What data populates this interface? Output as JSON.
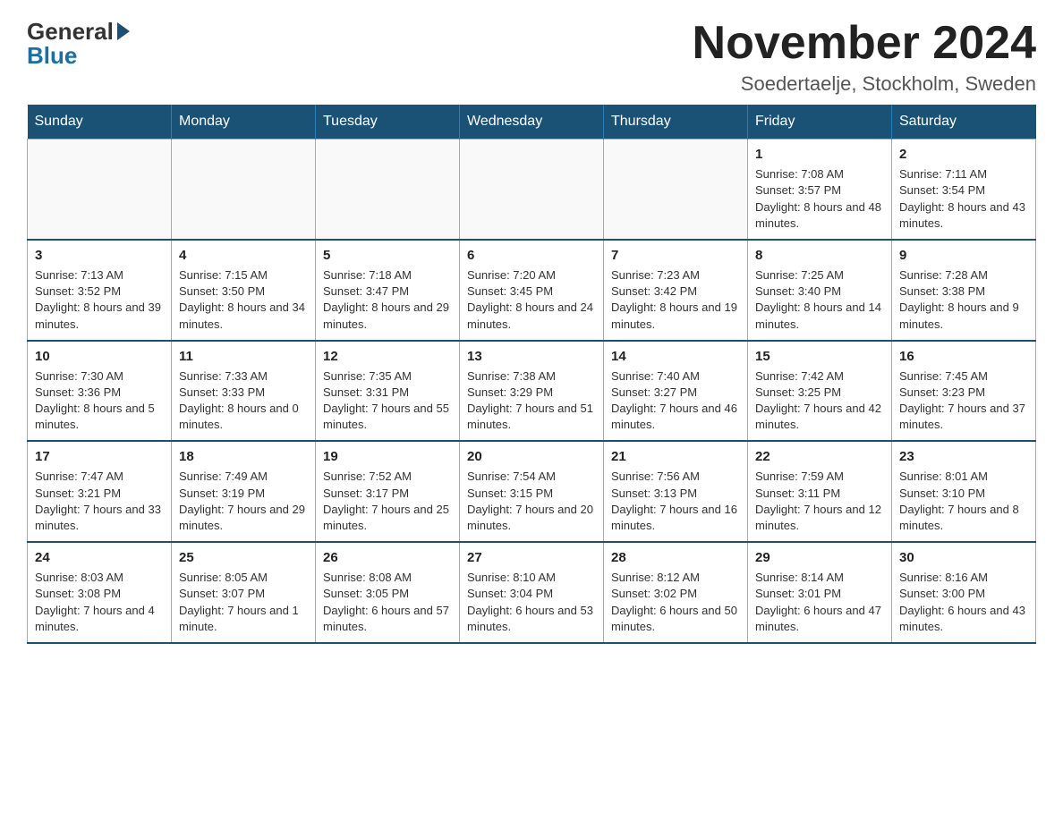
{
  "header": {
    "logo_text_general": "General",
    "logo_text_blue": "Blue",
    "month_title": "November 2024",
    "location": "Soedertaelje, Stockholm, Sweden"
  },
  "weekdays": [
    "Sunday",
    "Monday",
    "Tuesday",
    "Wednesday",
    "Thursday",
    "Friday",
    "Saturday"
  ],
  "weeks": [
    [
      {
        "day": "",
        "sunrise": "",
        "sunset": "",
        "daylight": ""
      },
      {
        "day": "",
        "sunrise": "",
        "sunset": "",
        "daylight": ""
      },
      {
        "day": "",
        "sunrise": "",
        "sunset": "",
        "daylight": ""
      },
      {
        "day": "",
        "sunrise": "",
        "sunset": "",
        "daylight": ""
      },
      {
        "day": "",
        "sunrise": "",
        "sunset": "",
        "daylight": ""
      },
      {
        "day": "1",
        "sunrise": "Sunrise: 7:08 AM",
        "sunset": "Sunset: 3:57 PM",
        "daylight": "Daylight: 8 hours and 48 minutes."
      },
      {
        "day": "2",
        "sunrise": "Sunrise: 7:11 AM",
        "sunset": "Sunset: 3:54 PM",
        "daylight": "Daylight: 8 hours and 43 minutes."
      }
    ],
    [
      {
        "day": "3",
        "sunrise": "Sunrise: 7:13 AM",
        "sunset": "Sunset: 3:52 PM",
        "daylight": "Daylight: 8 hours and 39 minutes."
      },
      {
        "day": "4",
        "sunrise": "Sunrise: 7:15 AM",
        "sunset": "Sunset: 3:50 PM",
        "daylight": "Daylight: 8 hours and 34 minutes."
      },
      {
        "day": "5",
        "sunrise": "Sunrise: 7:18 AM",
        "sunset": "Sunset: 3:47 PM",
        "daylight": "Daylight: 8 hours and 29 minutes."
      },
      {
        "day": "6",
        "sunrise": "Sunrise: 7:20 AM",
        "sunset": "Sunset: 3:45 PM",
        "daylight": "Daylight: 8 hours and 24 minutes."
      },
      {
        "day": "7",
        "sunrise": "Sunrise: 7:23 AM",
        "sunset": "Sunset: 3:42 PM",
        "daylight": "Daylight: 8 hours and 19 minutes."
      },
      {
        "day": "8",
        "sunrise": "Sunrise: 7:25 AM",
        "sunset": "Sunset: 3:40 PM",
        "daylight": "Daylight: 8 hours and 14 minutes."
      },
      {
        "day": "9",
        "sunrise": "Sunrise: 7:28 AM",
        "sunset": "Sunset: 3:38 PM",
        "daylight": "Daylight: 8 hours and 9 minutes."
      }
    ],
    [
      {
        "day": "10",
        "sunrise": "Sunrise: 7:30 AM",
        "sunset": "Sunset: 3:36 PM",
        "daylight": "Daylight: 8 hours and 5 minutes."
      },
      {
        "day": "11",
        "sunrise": "Sunrise: 7:33 AM",
        "sunset": "Sunset: 3:33 PM",
        "daylight": "Daylight: 8 hours and 0 minutes."
      },
      {
        "day": "12",
        "sunrise": "Sunrise: 7:35 AM",
        "sunset": "Sunset: 3:31 PM",
        "daylight": "Daylight: 7 hours and 55 minutes."
      },
      {
        "day": "13",
        "sunrise": "Sunrise: 7:38 AM",
        "sunset": "Sunset: 3:29 PM",
        "daylight": "Daylight: 7 hours and 51 minutes."
      },
      {
        "day": "14",
        "sunrise": "Sunrise: 7:40 AM",
        "sunset": "Sunset: 3:27 PM",
        "daylight": "Daylight: 7 hours and 46 minutes."
      },
      {
        "day": "15",
        "sunrise": "Sunrise: 7:42 AM",
        "sunset": "Sunset: 3:25 PM",
        "daylight": "Daylight: 7 hours and 42 minutes."
      },
      {
        "day": "16",
        "sunrise": "Sunrise: 7:45 AM",
        "sunset": "Sunset: 3:23 PM",
        "daylight": "Daylight: 7 hours and 37 minutes."
      }
    ],
    [
      {
        "day": "17",
        "sunrise": "Sunrise: 7:47 AM",
        "sunset": "Sunset: 3:21 PM",
        "daylight": "Daylight: 7 hours and 33 minutes."
      },
      {
        "day": "18",
        "sunrise": "Sunrise: 7:49 AM",
        "sunset": "Sunset: 3:19 PM",
        "daylight": "Daylight: 7 hours and 29 minutes."
      },
      {
        "day": "19",
        "sunrise": "Sunrise: 7:52 AM",
        "sunset": "Sunset: 3:17 PM",
        "daylight": "Daylight: 7 hours and 25 minutes."
      },
      {
        "day": "20",
        "sunrise": "Sunrise: 7:54 AM",
        "sunset": "Sunset: 3:15 PM",
        "daylight": "Daylight: 7 hours and 20 minutes."
      },
      {
        "day": "21",
        "sunrise": "Sunrise: 7:56 AM",
        "sunset": "Sunset: 3:13 PM",
        "daylight": "Daylight: 7 hours and 16 minutes."
      },
      {
        "day": "22",
        "sunrise": "Sunrise: 7:59 AM",
        "sunset": "Sunset: 3:11 PM",
        "daylight": "Daylight: 7 hours and 12 minutes."
      },
      {
        "day": "23",
        "sunrise": "Sunrise: 8:01 AM",
        "sunset": "Sunset: 3:10 PM",
        "daylight": "Daylight: 7 hours and 8 minutes."
      }
    ],
    [
      {
        "day": "24",
        "sunrise": "Sunrise: 8:03 AM",
        "sunset": "Sunset: 3:08 PM",
        "daylight": "Daylight: 7 hours and 4 minutes."
      },
      {
        "day": "25",
        "sunrise": "Sunrise: 8:05 AM",
        "sunset": "Sunset: 3:07 PM",
        "daylight": "Daylight: 7 hours and 1 minute."
      },
      {
        "day": "26",
        "sunrise": "Sunrise: 8:08 AM",
        "sunset": "Sunset: 3:05 PM",
        "daylight": "Daylight: 6 hours and 57 minutes."
      },
      {
        "day": "27",
        "sunrise": "Sunrise: 8:10 AM",
        "sunset": "Sunset: 3:04 PM",
        "daylight": "Daylight: 6 hours and 53 minutes."
      },
      {
        "day": "28",
        "sunrise": "Sunrise: 8:12 AM",
        "sunset": "Sunset: 3:02 PM",
        "daylight": "Daylight: 6 hours and 50 minutes."
      },
      {
        "day": "29",
        "sunrise": "Sunrise: 8:14 AM",
        "sunset": "Sunset: 3:01 PM",
        "daylight": "Daylight: 6 hours and 47 minutes."
      },
      {
        "day": "30",
        "sunrise": "Sunrise: 8:16 AM",
        "sunset": "Sunset: 3:00 PM",
        "daylight": "Daylight: 6 hours and 43 minutes."
      }
    ]
  ]
}
